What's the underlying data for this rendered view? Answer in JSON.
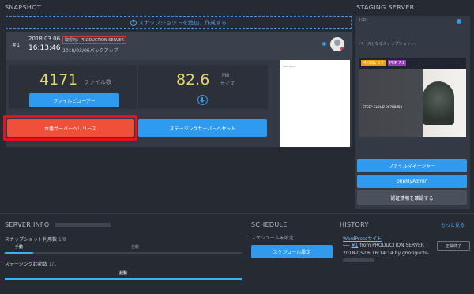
{
  "snapshot": {
    "section_title": "SNAPSHOT",
    "add_label": "スナップショットを追加、作成する",
    "entry": {
      "index": "#1",
      "date": "2018.03.06",
      "time": "16:13:46",
      "source_badge": "取得元：PRODUCTION SERVER",
      "backup_label": "2018/03/06バックアップ"
    },
    "file_count": {
      "value": "4171",
      "unit": "ファイル数"
    },
    "size": {
      "value": "82.6",
      "unit_top": "MB",
      "unit_bottom": "サイズ"
    },
    "file_viewer_label": "ファイルビューアー",
    "release_label": "本番サーバーへリリース",
    "staging_reset_label": "ステージングサーバーへセット",
    "preview_text": "Hello world"
  },
  "staging": {
    "section_title": "STAGING SERVER",
    "url_label": "URL:",
    "url_value": "",
    "base_snapshot_label": "ベースとなるスナップショット：",
    "mysql_badge": "MySQL 5.7",
    "php_badge": "PHP 7.1",
    "thumb_caption": "STEEP-CLOUD-967H8853",
    "file_manager_label": "ファイルマネージャー",
    "phpmyadmin_label": "phpMyAdmin",
    "access_info_label": "認証情報を確認する"
  },
  "server_info": {
    "section_title": "SERVER INFO",
    "snapshot_usage_label": "スナップショット利用数",
    "snapshot_usage_count": "1/8",
    "manual_label": "手動",
    "auto_label": "自動",
    "staging_label": "ステージング起動数",
    "staging_count": "1/1",
    "running_label": "起動"
  },
  "schedule": {
    "section_title": "SCHEDULE",
    "none_label": "スケジュール未設定",
    "set_button": "スケジュール設定"
  },
  "history": {
    "section_title": "HISTORY",
    "more_link": "もっと見る",
    "item_title": "WordPressサイト",
    "item_ref": "#1",
    "item_from": "from PRODUCTION SERVER",
    "item_time": "2018-03-06 16:14:14",
    "item_by": "by",
    "item_user": "ghoriguchi-",
    "item_status": "正常終了"
  },
  "colors": {
    "accent_blue": "#2e9bf0",
    "release_red": "#f0503a",
    "highlight_red": "#e8101a",
    "bg": "#262a33"
  }
}
